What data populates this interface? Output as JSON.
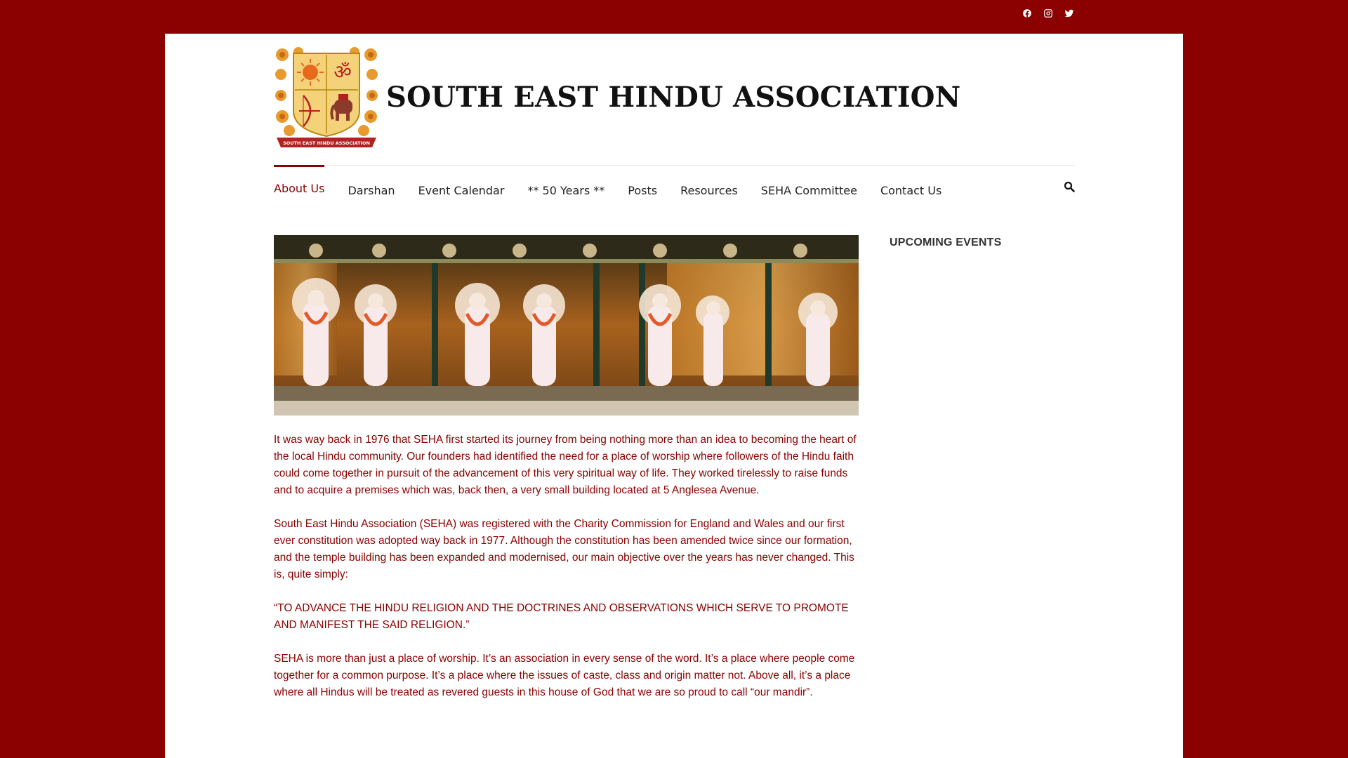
{
  "social": {
    "items": [
      {
        "icon": "facebook-icon"
      },
      {
        "icon": "instagram-icon"
      },
      {
        "icon": "twitter-icon"
      }
    ]
  },
  "header": {
    "site_title": "SOUTH EAST HINDU ASSOCIATION",
    "logo_text": "SOUTH EAST HINDU ASSOCIATION"
  },
  "nav": {
    "items": [
      {
        "label": "About Us"
      },
      {
        "label": "Darshan"
      },
      {
        "label": "Event Calendar"
      },
      {
        "label": "** 50 Years **"
      },
      {
        "label": "Posts"
      },
      {
        "label": "Resources"
      },
      {
        "label": "SEHA Committee"
      },
      {
        "label": "Contact Us"
      }
    ],
    "active_index": 0
  },
  "content": {
    "paragraphs": [
      "It was way back in 1976 that SEHA first started its journey from being nothing more than an idea to becoming the heart of the local Hindu community. Our founders had identified the need for a place of worship where followers of the Hindu faith could come together in pursuit of the advancement of this very spiritual way of life. They worked tirelessly to raise funds and to acquire a premises which was, back then, a very small building located at 5 Anglesea Avenue.",
      "South East Hindu Association (SEHA) was registered with the Charity Commission for England and Wales and our first ever constitution was adopted way back in 1977. Although the constitution has been amended twice since our formation, and the temple building has been expanded and modernised, our main objective over the years has never changed. This is, quite simply:",
      "“TO ADVANCE THE HINDU RELIGION AND THE DOCTRINES AND OBSERVATIONS WHICH SERVE TO PROMOTE AND MANIFEST THE SAID RELIGION.”",
      "SEHA is more than just a place of worship. It’s an association in every sense of the word. It’s a place where people come together for a common purpose. It’s a place where the issues of caste, class and origin matter not. Above all, it’s a place where all Hindus will be treated as revered guests in this house of God that we are so proud to call “our mandir”."
    ]
  },
  "sidebar": {
    "widget_title": "UPCOMING EVENTS"
  },
  "colors": {
    "brand": "#8b0000",
    "text": "#222222",
    "gold": "#e8a33b"
  }
}
